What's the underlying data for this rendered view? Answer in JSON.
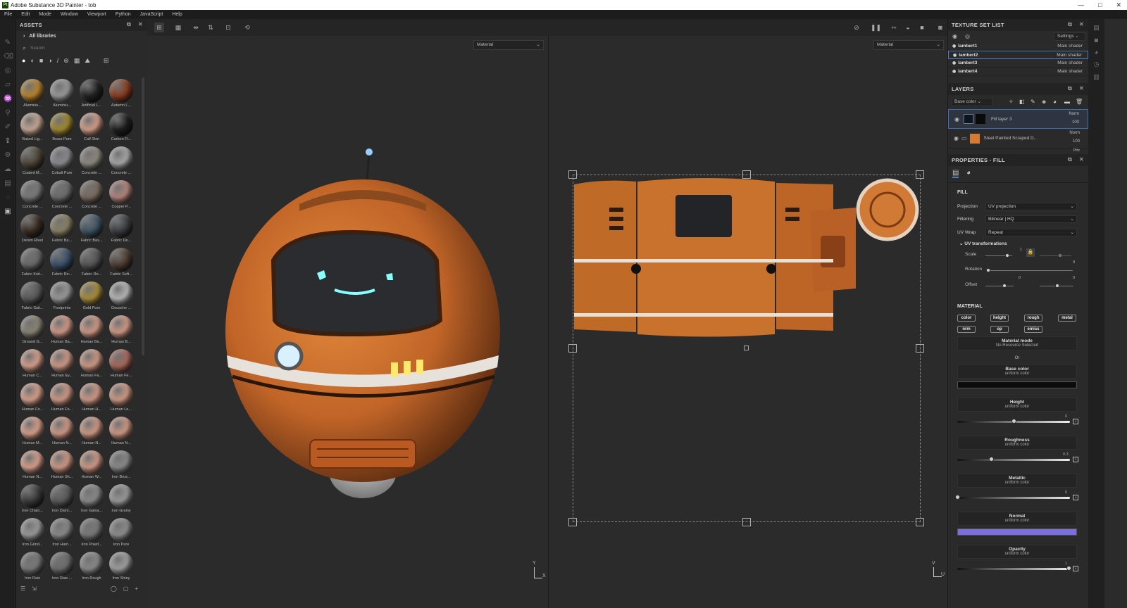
{
  "window": {
    "title": "Adobe Substance 3D Painter - tob",
    "logo": "Pt",
    "controls": [
      "—",
      "□",
      "✕"
    ]
  },
  "menu": [
    "File",
    "Edit",
    "Mode",
    "Window",
    "Viewport",
    "Python",
    "JavaScript",
    "Help"
  ],
  "assets": {
    "title": "ASSETS",
    "library": "All libraries",
    "search_placeholder": "Search",
    "items": [
      {
        "name": "Aluminiu...",
        "color": "#b8842e"
      },
      {
        "name": "Aluminiu...",
        "color": "#9a9a9a"
      },
      {
        "name": "Artificial L...",
        "color": "#222222"
      },
      {
        "name": "Autumn L...",
        "color": "#8a3c1e"
      },
      {
        "name": "Baked Lig...",
        "color": "#c8a893"
      },
      {
        "name": "Brass Pure",
        "color": "#a08a30"
      },
      {
        "name": "Calf Skin",
        "color": "#d39e8a"
      },
      {
        "name": "Carbon Fi...",
        "color": "#1e1e1e"
      },
      {
        "name": "Coated M...",
        "color": "#4e4638"
      },
      {
        "name": "Cobalt Pure",
        "color": "#8c8c90"
      },
      {
        "name": "Concrete ...",
        "color": "#8e8a82"
      },
      {
        "name": "Concrete ...",
        "color": "#a8a8a8"
      },
      {
        "name": "Concrete ...",
        "color": "#7a7a7a"
      },
      {
        "name": "Concrete ...",
        "color": "#6d6d6d"
      },
      {
        "name": "Concrete ...",
        "color": "#7a6c60"
      },
      {
        "name": "Copper P...",
        "color": "#b3857c"
      },
      {
        "name": "Denim Rivet",
        "color": "#3a2c22"
      },
      {
        "name": "Fabric Ba...",
        "color": "#8a8266"
      },
      {
        "name": "Fabric Bas...",
        "color": "#405666"
      },
      {
        "name": "Fabric De...",
        "color": "#3c3e42"
      },
      {
        "name": "Fabric Knit...",
        "color": "#6a6a6a"
      },
      {
        "name": "Fabric Ro...",
        "color": "#3a506a"
      },
      {
        "name": "Fabric Ro...",
        "color": "#555555"
      },
      {
        "name": "Fabric Soft...",
        "color": "#4e3e32"
      },
      {
        "name": "Fabric Suit...",
        "color": "#5a5a5a"
      },
      {
        "name": "Footprints",
        "color": "#9a9a9a"
      },
      {
        "name": "Gold Pure",
        "color": "#a88e3a"
      },
      {
        "name": "Gouache ...",
        "color": "#b8b8b8"
      },
      {
        "name": "Ground G...",
        "color": "#8a8476"
      },
      {
        "name": "Human Ba...",
        "color": "#d09a86"
      },
      {
        "name": "Human Be...",
        "color": "#d09a86"
      },
      {
        "name": "Human B...",
        "color": "#d09a86"
      },
      {
        "name": "Human C...",
        "color": "#d8a08c"
      },
      {
        "name": "Human Ey...",
        "color": "#d09a86"
      },
      {
        "name": "Human Fa...",
        "color": "#d09a86"
      },
      {
        "name": "Human Fe...",
        "color": "#a8685a"
      },
      {
        "name": "Human Fo...",
        "color": "#d8a08c"
      },
      {
        "name": "Human Fo...",
        "color": "#d09a86"
      },
      {
        "name": "Human H...",
        "color": "#d09a86"
      },
      {
        "name": "Human Le...",
        "color": "#d09a86"
      },
      {
        "name": "Human M...",
        "color": "#d8a08c"
      },
      {
        "name": "Human N...",
        "color": "#d09a86"
      },
      {
        "name": "Human N...",
        "color": "#d09a86"
      },
      {
        "name": "Human N...",
        "color": "#d09a86"
      },
      {
        "name": "Human N...",
        "color": "#d8a08c"
      },
      {
        "name": "Human Sh...",
        "color": "#d09a86"
      },
      {
        "name": "Human W...",
        "color": "#d09a86"
      },
      {
        "name": "Iron Brus...",
        "color": "#8a8a8a"
      },
      {
        "name": "Iron Chain...",
        "color": "#3a3a3a"
      },
      {
        "name": "Iron Diam...",
        "color": "#5a5a5a"
      },
      {
        "name": "Iron Galva...",
        "color": "#8a8a8a"
      },
      {
        "name": "Iron Grainy",
        "color": "#9a9a9a"
      },
      {
        "name": "Iron Grind...",
        "color": "#9a9a9a"
      },
      {
        "name": "Iron Ham...",
        "color": "#8a8a8a"
      },
      {
        "name": "Iron Powd...",
        "color": "#7a7a7a"
      },
      {
        "name": "Iron Pure",
        "color": "#8e8e8e"
      },
      {
        "name": "Iron Raw",
        "color": "#7a7a7a"
      },
      {
        "name": "Iron Raw ...",
        "color": "#6e6e6e"
      },
      {
        "name": "Iron Rough",
        "color": "#8a8a8a"
      },
      {
        "name": "Iron Shiny",
        "color": "#a0a0a0"
      }
    ]
  },
  "viewport": {
    "left_mode": "Material",
    "right_mode": "Material",
    "axis_left": [
      "Y",
      "X"
    ],
    "axis_right": [
      "V",
      "U"
    ]
  },
  "texture_sets": {
    "title": "TEXTURE SET LIST",
    "settings": "Settings",
    "rows": [
      {
        "name": "lambert1",
        "shader": "Main shader"
      },
      {
        "name": "lambert2",
        "shader": "Main shader"
      },
      {
        "name": "lambert3",
        "shader": "Main shader"
      },
      {
        "name": "lambert4",
        "shader": "Main shader"
      }
    ]
  },
  "layers": {
    "title": "LAYERS",
    "channel": "Base color",
    "rows": [
      {
        "name": "Fill layer 3",
        "blend": "Norm",
        "opacity": "100"
      },
      {
        "name": "Steel Painted Scraped D...",
        "blend": "Norm",
        "opacity": "100"
      }
    ],
    "partial": "Pthr"
  },
  "properties": {
    "title": "PROPERTIES - FILL",
    "fill_label": "FILL",
    "projection": {
      "label": "Projection",
      "value": "UV projection"
    },
    "filtering": {
      "label": "Filtering",
      "value": "Bilinear | HQ"
    },
    "uvwrap": {
      "label": "UV Wrap",
      "value": "Repeat"
    },
    "uvt": "UV transformations",
    "scale": "Scale",
    "scale_val": "1",
    "rotation": "Rotation",
    "rotation_val": "0",
    "offset": "Offset",
    "offset_v1": "0",
    "offset_v2": "0",
    "scale_val2": "0",
    "material_label": "MATERIAL",
    "channels": [
      "color",
      "height",
      "rough",
      "metal",
      "nrm",
      "op",
      "emiss"
    ],
    "material_mode": {
      "title": "Material mode",
      "sub": "No Resource Selected"
    },
    "or": "Or",
    "params": [
      {
        "title": "Base color",
        "sub": "uniform color"
      },
      {
        "title": "Height",
        "sub": "uniform color",
        "value": "0"
      },
      {
        "title": "Roughness",
        "sub": "uniform color",
        "value": "0.3"
      },
      {
        "title": "Metallic",
        "sub": "uniform color",
        "value": "0"
      },
      {
        "title": "Normal",
        "sub": "uniform color"
      },
      {
        "title": "Opacity",
        "sub": "uniform color",
        "value": "1"
      }
    ],
    "normal_color": "#7b6fe0",
    "base_color": "#0d0d0d"
  }
}
